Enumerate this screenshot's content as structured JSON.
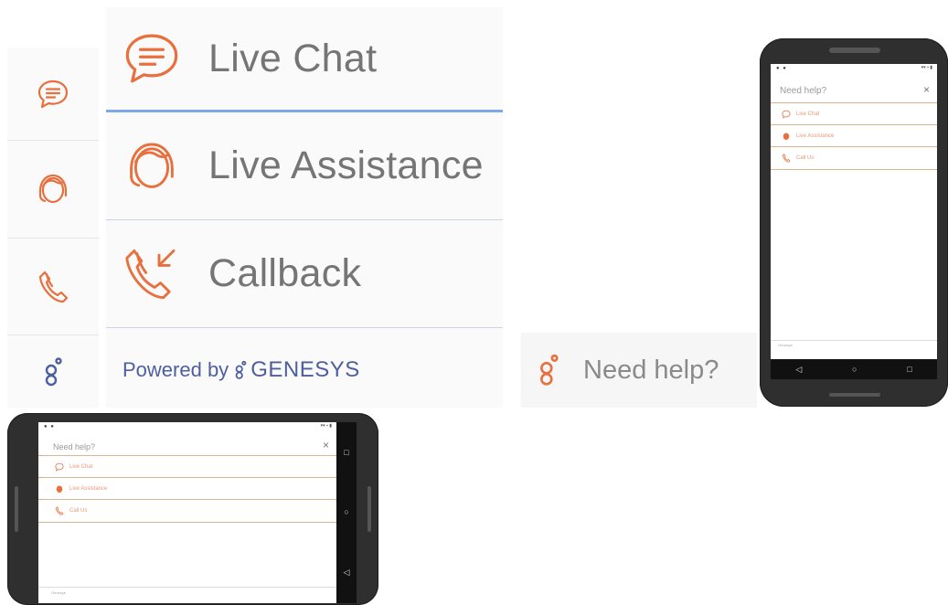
{
  "colors": {
    "accent": "#e8703f",
    "divider_active": "#7fa8e6",
    "brand_text": "#4e5f9e"
  },
  "rail": {
    "items": [
      {
        "icon": "chat-bubble-icon"
      },
      {
        "icon": "agent-headset-icon"
      },
      {
        "icon": "phone-icon"
      },
      {
        "icon": "genesys-logo-icon"
      }
    ]
  },
  "menu": {
    "items": [
      {
        "label": "Live Chat",
        "icon": "chat-bubble-icon"
      },
      {
        "label": "Live Assistance",
        "icon": "agent-headset-icon"
      },
      {
        "label": "Callback",
        "icon": "callback-phone-icon"
      }
    ],
    "powered_by": "Powered by",
    "brand": "GENESYS"
  },
  "launcher": {
    "label": "Need help?",
    "icon": "genesys-logo-icon"
  },
  "phone": {
    "title": "Need help?",
    "close": "×",
    "items": [
      {
        "label": "Live Chat"
      },
      {
        "label": "Live Assistance"
      },
      {
        "label": "Call Us"
      }
    ],
    "footer": "Genesys",
    "nav": {
      "back": "◁",
      "home": "○",
      "recents": "□"
    }
  }
}
